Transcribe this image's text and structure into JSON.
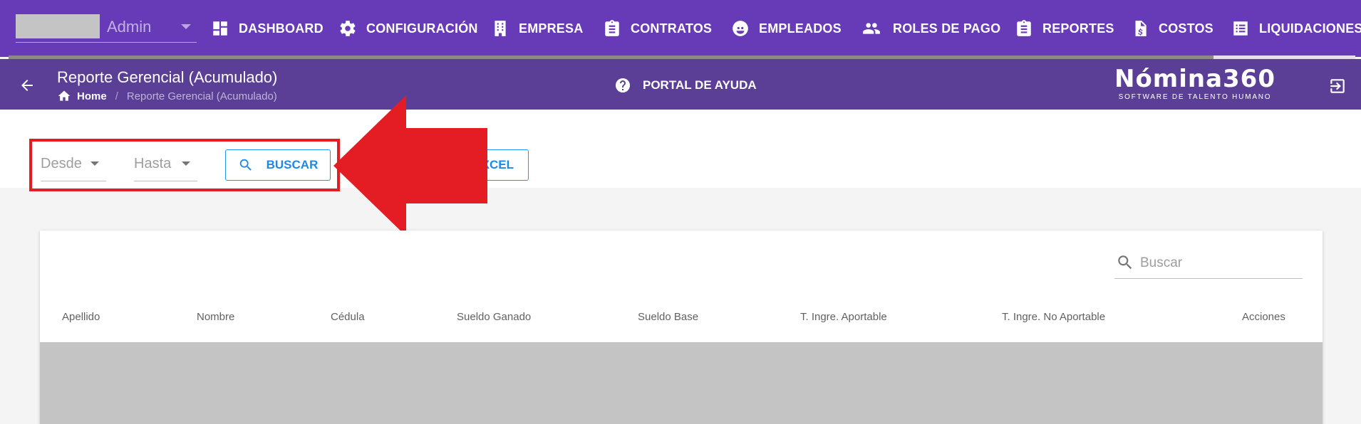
{
  "user": {
    "name": "Admin"
  },
  "nav": {
    "items": [
      {
        "label": "DASHBOARD"
      },
      {
        "label": "CONFIGURACIÓN"
      },
      {
        "label": "EMPRESA"
      },
      {
        "label": "CONTRATOS"
      },
      {
        "label": "EMPLEADOS"
      },
      {
        "label": "ROLES DE PAGO"
      },
      {
        "label": "REPORTES"
      },
      {
        "label": "COSTOS"
      },
      {
        "label": "LIQUIDACIONES"
      }
    ]
  },
  "header": {
    "title": "Reporte Gerencial (Acumulado)",
    "breadcrumb": {
      "home": "Home",
      "separator": "/",
      "current": "Reporte Gerencial (Acumulado)"
    },
    "help_label": "PORTAL DE AYUDA",
    "logo_main": "Nómina360",
    "logo_sub": "SOFTWARE DE TALENTO HUMANO"
  },
  "filters": {
    "desde_label": "Desde",
    "hasta_label": "Hasta",
    "buscar_label": "BUSCAR",
    "excel_label": "XCEL"
  },
  "table": {
    "search_placeholder": "Buscar",
    "columns": [
      "Apellido",
      "Nombre",
      "Cédula",
      "Sueldo Ganado",
      "Sueldo Base",
      "T. Ingre. Aportable",
      "T. Ingre. No Aportable",
      "Acciones"
    ]
  },
  "colors": {
    "nav_bg": "#673ab7",
    "subheader_bg": "#5b3f96",
    "accent_blue": "#1e88e5",
    "annotation_red": "#e41c24"
  }
}
